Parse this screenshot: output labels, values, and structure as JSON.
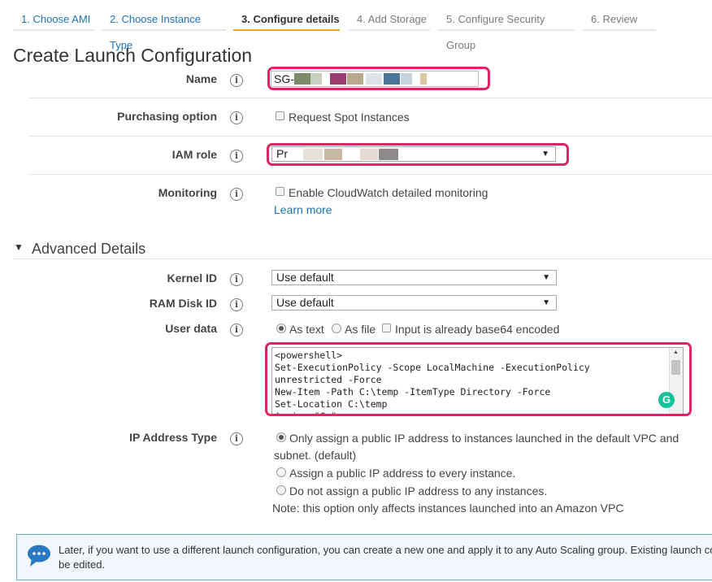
{
  "tabs": [
    {
      "label": "1. Choose AMI"
    },
    {
      "label": "2. Choose Instance Type"
    },
    {
      "label": "3. Configure details"
    },
    {
      "label": "4. Add Storage"
    },
    {
      "label": "5. Configure Security Group"
    },
    {
      "label": "6. Review"
    }
  ],
  "page_title": "Create Launch Configuration",
  "info_symbol": "i",
  "fields": {
    "name": {
      "label": "Name",
      "value": "SG-"
    },
    "purchasing": {
      "label": "Purchasing option",
      "checkbox_label": "Request Spot Instances"
    },
    "iam_role": {
      "label": "IAM role",
      "value": "Pr"
    },
    "monitoring": {
      "label": "Monitoring",
      "checkbox_label": "Enable CloudWatch detailed monitoring",
      "learn_more": "Learn more"
    }
  },
  "advanced": {
    "heading": "Advanced Details",
    "kernel_id": {
      "label": "Kernel ID",
      "value": "Use default"
    },
    "ram_disk_id": {
      "label": "RAM Disk ID",
      "value": "Use default"
    },
    "user_data": {
      "label": "User data",
      "as_text": "As text",
      "as_file": "As file",
      "base64_label": "Input is already base64 encoded",
      "content": "<powershell>\nSet-ExecutionPolicy -Scope LocalMachine -ExecutionPolicy unrestricted -Force\nNew-Item -Path C:\\temp -ItemType Directory -Force\nSet-Location C:\\temp\n$uri = \"C:\""
    },
    "ip_address_type": {
      "label": "IP Address Type",
      "option1_line1": "Only assign a public IP address to instances launched in the default VPC and",
      "option1_line2": "subnet. (default)",
      "option2": "Assign a public IP address to every instance.",
      "option3": "Do not assign a public IP address to any instances.",
      "note": "Note: this option only affects instances launched into an Amazon VPC"
    }
  },
  "info_banner": {
    "line1": "Later, if you want to use a different launch configuration, you can create a new one and apply it to any Auto Scaling group. Existing launch co",
    "line2": "be edited."
  },
  "colors": {
    "highlight": "#e0245e",
    "link": "#1a73b5",
    "active_tab_underline": "#e5a32c",
    "banner_icon": "#2a78c2",
    "grammarly": "#15c39a"
  }
}
